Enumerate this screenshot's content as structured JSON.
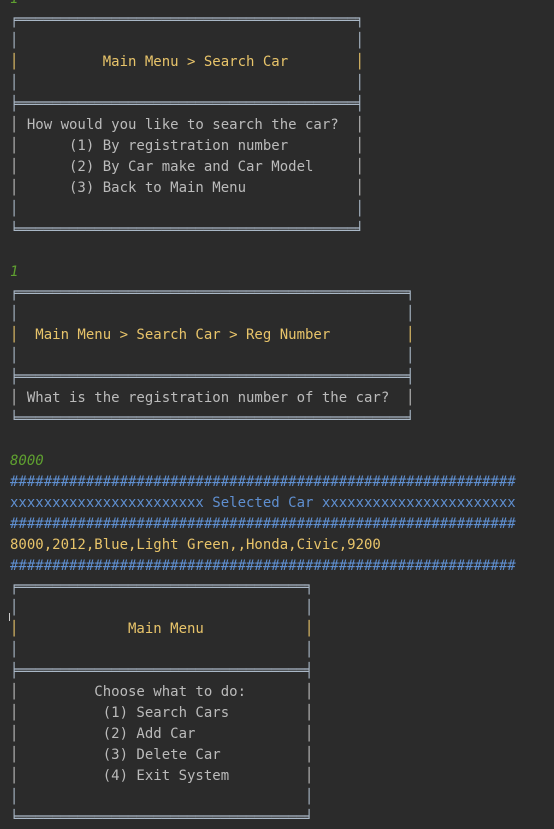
{
  "console": {
    "lines": [
      {
        "t": "1",
        "c": "input"
      },
      {
        "t": "╒════════════════════════════════════════╕",
        "c": "box"
      },
      {
        "t": "│                                        │",
        "c": "box"
      },
      {
        "t": "│          Main Menu > Search Car        │",
        "c": "title"
      },
      {
        "t": "│                                        │",
        "c": "box"
      },
      {
        "t": "╞════════════════════════════════════════╡",
        "c": "box"
      },
      {
        "t": "│ How would you like to search the car?  │",
        "c": "text"
      },
      {
        "t": "│      (1) By registration number        │",
        "c": "text"
      },
      {
        "t": "│      (2) By Car make and Car Model     │",
        "c": "text"
      },
      {
        "t": "│      (3) Back to Main Menu             │",
        "c": "text"
      },
      {
        "t": "│                                        │",
        "c": "box"
      },
      {
        "t": "╘════════════════════════════════════════╛",
        "c": "box"
      },
      {
        "t": "",
        "c": "text"
      },
      {
        "t": "1",
        "c": "input"
      },
      {
        "t": "╒══════════════════════════════════════════════╕",
        "c": "box"
      },
      {
        "t": "│                                              │",
        "c": "box"
      },
      {
        "t": "│  Main Menu > Search Car > Reg Number         │",
        "c": "title"
      },
      {
        "t": "│                                              │",
        "c": "box"
      },
      {
        "t": "╞══════════════════════════════════════════════╡",
        "c": "box"
      },
      {
        "t": "│ What is the registration number of the car?  │",
        "c": "text"
      },
      {
        "t": "╘══════════════════════════════════════════════╛",
        "c": "box"
      },
      {
        "t": "",
        "c": "text"
      },
      {
        "t": "8000",
        "c": "input"
      },
      {
        "t": "############################################################",
        "c": "hash"
      },
      {
        "t": "xxxxxxxxxxxxxxxxxxxxxxx Selected Car xxxxxxxxxxxxxxxxxxxxxxx",
        "c": "selected"
      },
      {
        "t": "############################################################",
        "c": "hash"
      },
      {
        "t": "8000,2012,Blue,Light Green,,Honda,Civic,9200",
        "c": "result"
      },
      {
        "t": "############################################################",
        "c": "hash"
      },
      {
        "t": "╒══════════════════════════════════╕",
        "c": "box"
      },
      {
        "t": "│                                  │",
        "c": "box"
      },
      {
        "t": "│             Main Menu            │",
        "c": "title"
      },
      {
        "t": "│                                  │",
        "c": "box"
      },
      {
        "t": "╞══════════════════════════════════╡",
        "c": "box"
      },
      {
        "t": "│         Choose what to do:       │",
        "c": "text"
      },
      {
        "t": "│          (1) Search Cars         │",
        "c": "text"
      },
      {
        "t": "│          (2) Add Car             │",
        "c": "text"
      },
      {
        "t": "│          (3) Delete Car          │",
        "c": "text"
      },
      {
        "t": "│          (4) Exit System         │",
        "c": "text"
      },
      {
        "t": "│                                  │",
        "c": "box"
      },
      {
        "t": "╘══════════════════════════════════╛",
        "c": "box"
      }
    ]
  },
  "colors": {
    "background": "#2b2b2b",
    "title": "#e8c46a",
    "input": "#5fa030",
    "hash": "#5f8fd0",
    "text": "#bbbbbb"
  }
}
